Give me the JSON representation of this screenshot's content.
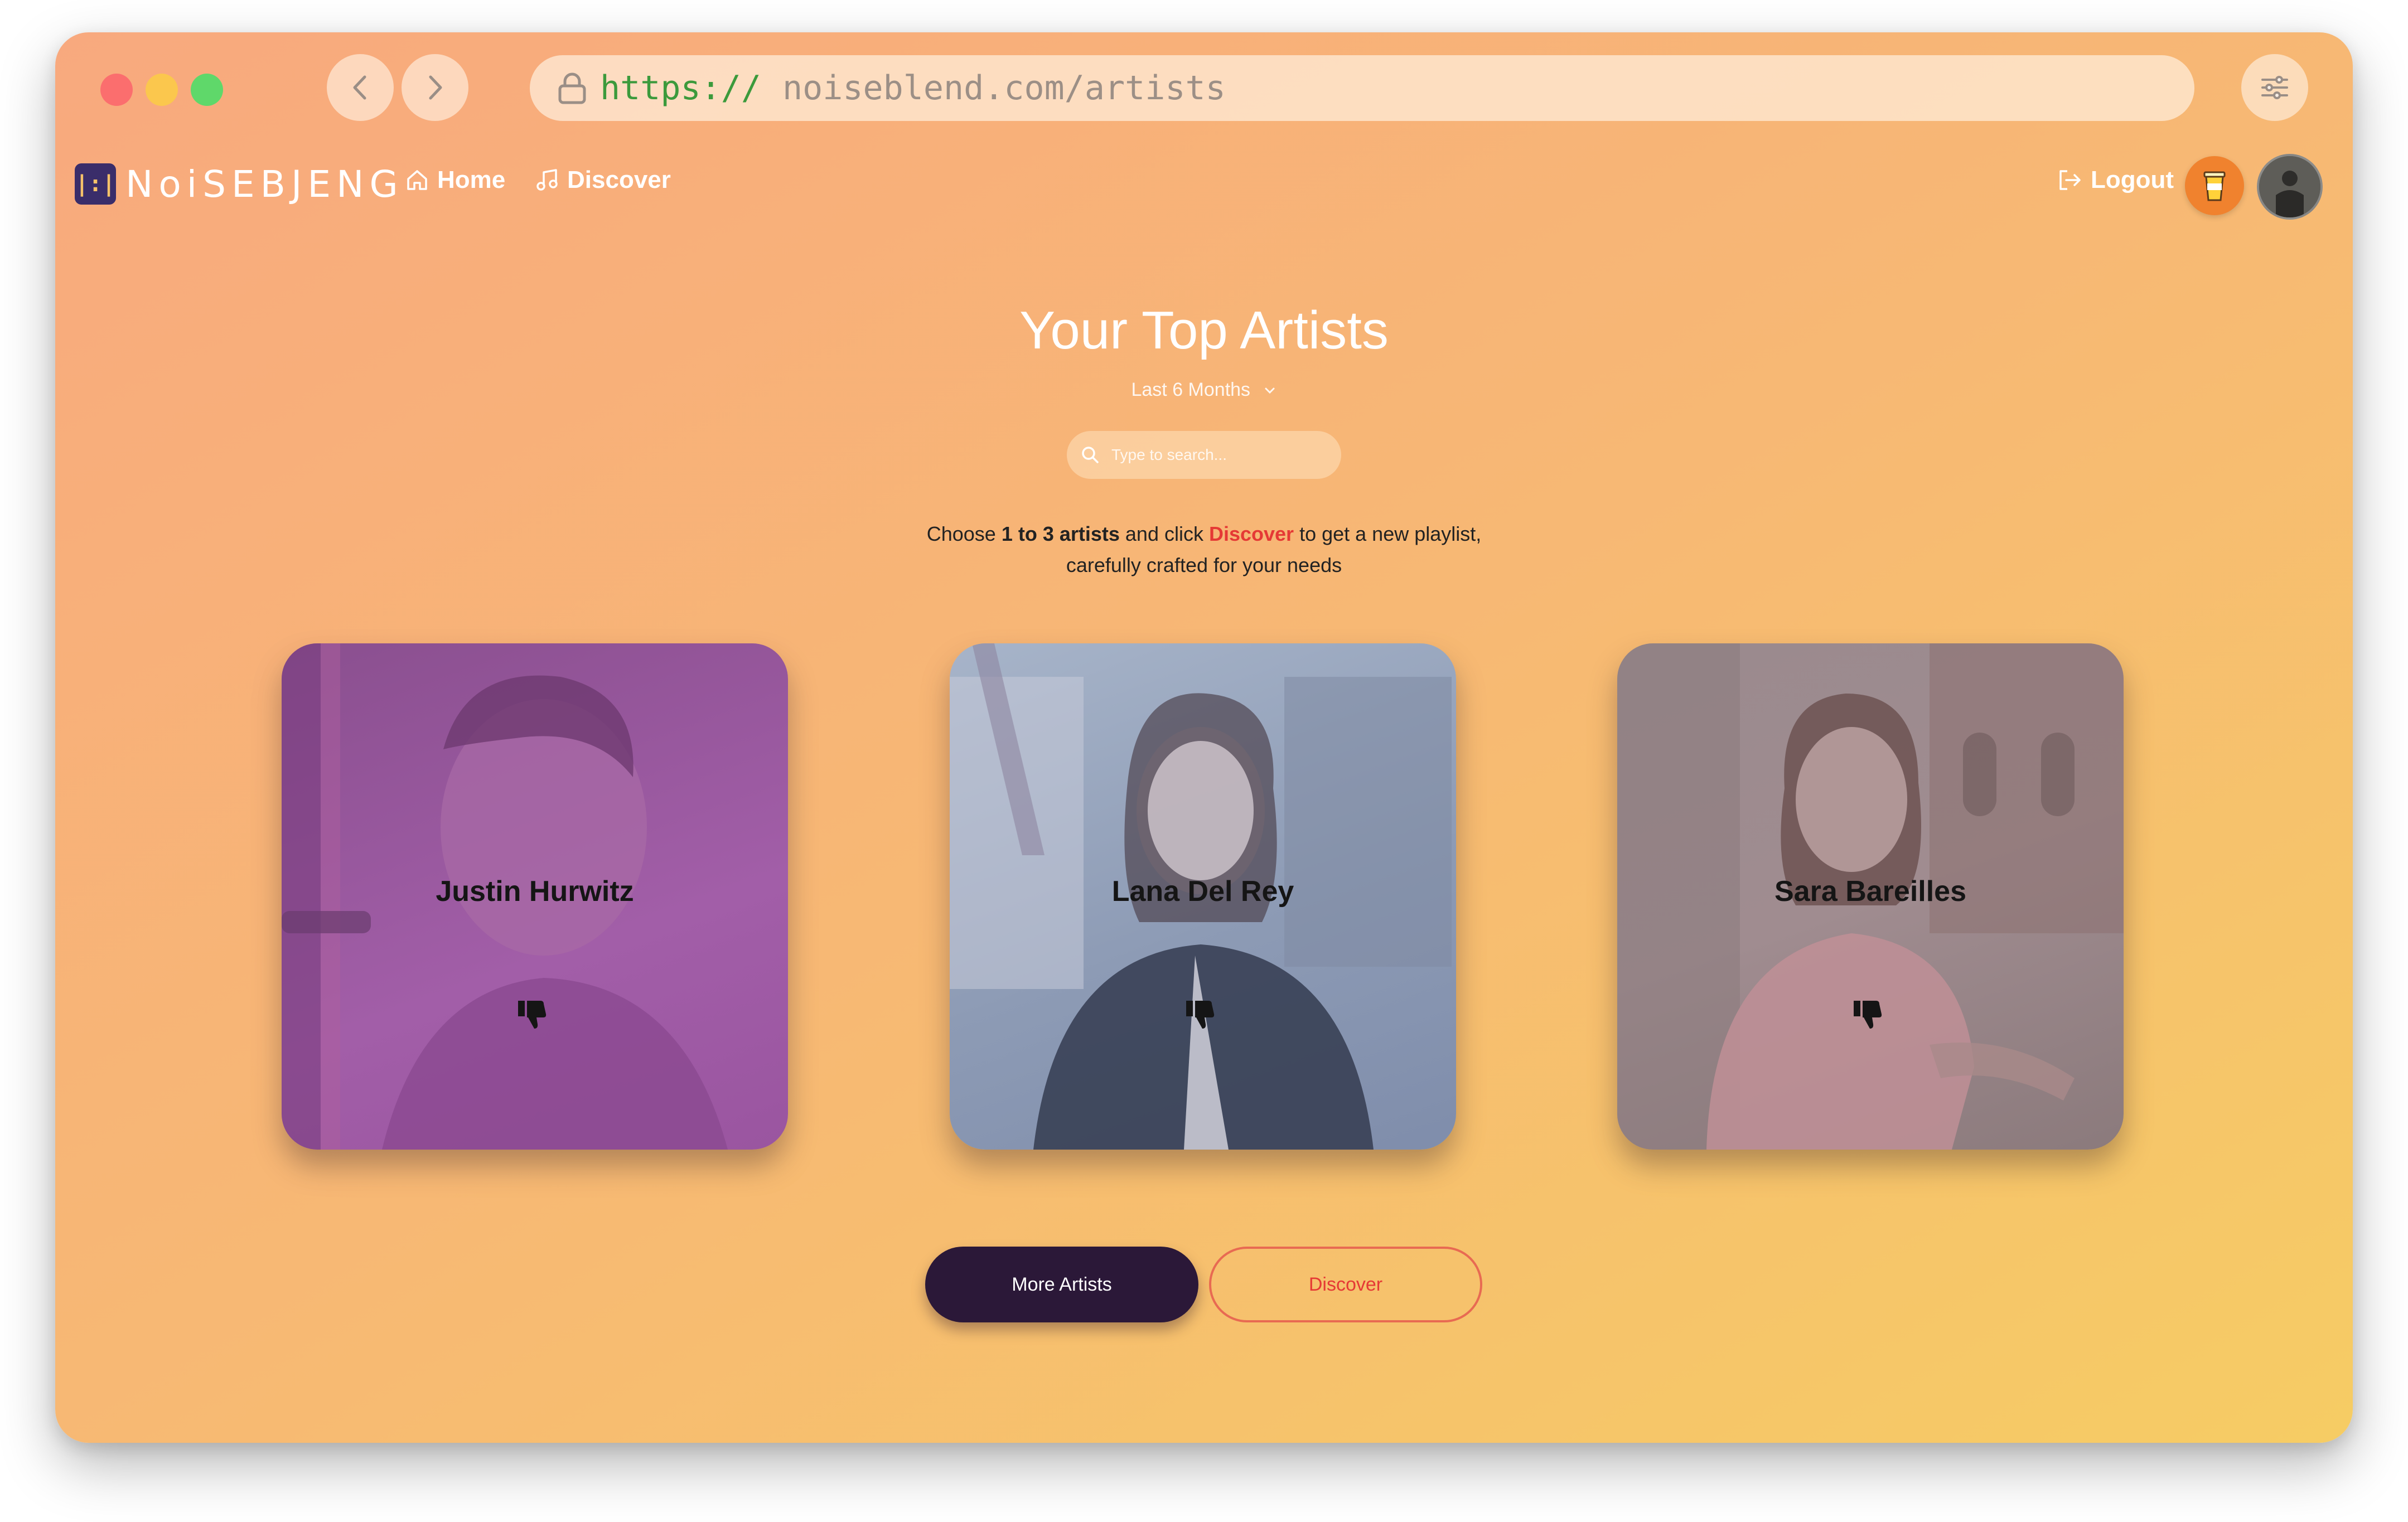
{
  "browser": {
    "url_protocol": "https://",
    "url_host": "noiseblend.com/artists",
    "traffic_lights": [
      "#fb6e6e",
      "#fbc74d",
      "#5fd86a"
    ]
  },
  "app": {
    "logo_mark": "|:|",
    "logo_text": "NoiSEBJENG",
    "nav": {
      "home_label": "Home",
      "discover_label": "Discover",
      "logout_label": "Logout"
    }
  },
  "main": {
    "title": "Your Top Artists",
    "time_range": "Last 6 Months",
    "search_placeholder": "Type to search...",
    "instructions": {
      "part1": "Choose ",
      "bold": "1 to 3 artists",
      "part2": " and click ",
      "accent": "Discover",
      "part3": " to get a new playlist,",
      "line2": "carefully crafted for your needs"
    },
    "artists": [
      {
        "name": "Justin Hurwitz"
      },
      {
        "name": "Lana Del Rey"
      },
      {
        "name": "Sara Bareilles"
      }
    ],
    "buttons": {
      "more_artists": "More Artists",
      "discover": "Discover"
    }
  },
  "colors": {
    "accent_red": "#e53935",
    "dark_button": "#2b1838",
    "gradient_start": "#f8a97e",
    "gradient_end": "#f6cc64"
  },
  "icons": [
    "lock-icon",
    "chevron-left-icon",
    "chevron-right-icon",
    "sliders-icon",
    "home-icon",
    "music-note-icon",
    "logout-icon",
    "coffee-cup-icon",
    "search-icon",
    "chevron-down-icon",
    "thumbs-down-icon"
  ]
}
